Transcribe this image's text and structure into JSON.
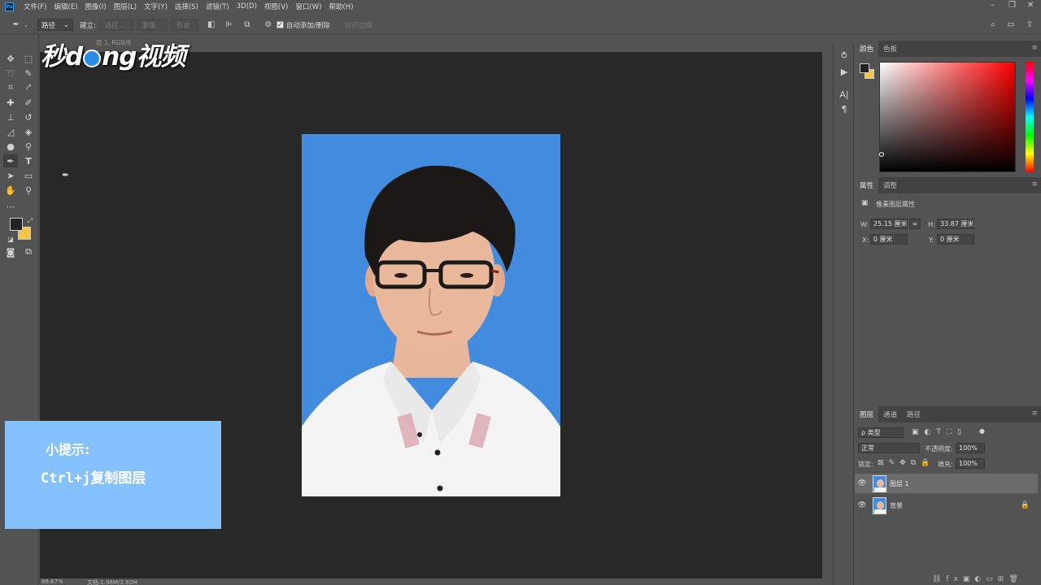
{
  "menubar": {
    "items": [
      "文件(F)",
      "编辑(E)",
      "图像(I)",
      "图层(L)",
      "文字(Y)",
      "选择(S)",
      "滤镜(T)",
      "3D(D)",
      "视图(V)",
      "窗口(W)",
      "帮助(H)"
    ]
  },
  "options": {
    "mode_value": "路径",
    "build_label": "建立:",
    "selection_btn": "选区...",
    "mask_btn": "蒙版",
    "shape_btn": "形状",
    "auto_add_label": "自动添加/删除",
    "align_edges_label": "对齐边缘"
  },
  "document": {
    "tab_fragment": "层 1, RGB/8"
  },
  "watermark": {
    "left": "秒",
    "d": "d",
    "ng": "ng",
    "right": "视频"
  },
  "tip": {
    "line1": "小提示:",
    "line2": "Ctrl+j复制图层"
  },
  "status": {
    "zoom": "66.67%",
    "doc_info": "文档:1.96M/3.92M"
  },
  "color_panel": {
    "tabs": [
      "颜色",
      "色板"
    ],
    "foreground": "#222222",
    "background": "#f5c744"
  },
  "properties_panel": {
    "tabs": [
      "属性",
      "调整"
    ],
    "title": "像素图层属性",
    "w_label": "W:",
    "w_value": "25.15 厘米",
    "h_label": "H:",
    "h_value": "33.87 厘米",
    "x_label": "X:",
    "x_value": "0 厘米",
    "y_label": "Y:",
    "y_value": "0 厘米"
  },
  "layers_panel": {
    "tabs": [
      "图层",
      "通道",
      "路径"
    ],
    "filter_value": "ρ 类型",
    "blend_mode": "正常",
    "opacity_label": "不透明度:",
    "opacity_value": "100%",
    "lock_label": "锁定:",
    "fill_label": "填充:",
    "fill_value": "100%",
    "layers": [
      {
        "name": "图层 1",
        "selected": true
      },
      {
        "name": "背景",
        "selected": false
      }
    ]
  },
  "colors": {
    "photo_bg": "#418cdf",
    "tip_bg": "#84c1fd",
    "ui_panel": "#535353",
    "canvas": "#282828"
  }
}
